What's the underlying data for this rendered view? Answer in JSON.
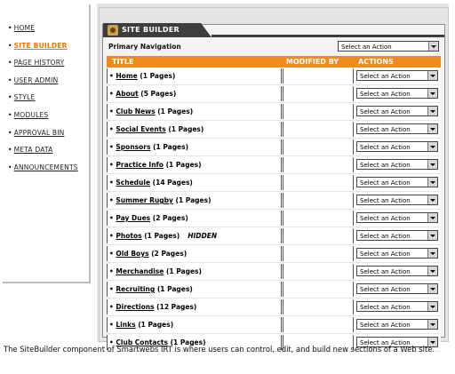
{
  "nav": {
    "items": [
      {
        "label": "HOME",
        "active": false
      },
      {
        "label": "SITE BUILDER",
        "active": true
      },
      {
        "label": "PAGE HISTORY",
        "active": false
      },
      {
        "label": "USER ADMIN",
        "active": false
      },
      {
        "label": "STYLE",
        "active": false
      },
      {
        "label": "MODULES",
        "active": false
      },
      {
        "label": "APPROVAL BIN",
        "active": false
      },
      {
        "label": "META DATA",
        "active": false
      },
      {
        "label": "ANNOUNCEMENTS",
        "active": false
      }
    ]
  },
  "panel": {
    "title": "SITE BUILDER",
    "primary_label": "Primary Navigation",
    "primary_select": "Select an Action"
  },
  "table": {
    "headers": {
      "title": "TITLE",
      "modified": "MODIFIED BY",
      "actions": "ACTIONS"
    },
    "action_default": "Select an Action",
    "rows": [
      {
        "name": "Home",
        "count": "(1 Pages)",
        "note": ""
      },
      {
        "name": "About",
        "count": "(5 Pages)",
        "note": ""
      },
      {
        "name": "Club News",
        "count": "(1 Pages)",
        "note": ""
      },
      {
        "name": "Social Events",
        "count": "(1 Pages)",
        "note": ""
      },
      {
        "name": "Sponsors",
        "count": "(1 Pages)",
        "note": ""
      },
      {
        "name": "Practice Info",
        "count": "(1 Pages)",
        "note": ""
      },
      {
        "name": "Schedule",
        "count": "(14 Pages)",
        "note": ""
      },
      {
        "name": "Summer Rugby",
        "count": "(1 Pages)",
        "note": ""
      },
      {
        "name": "Pay Dues",
        "count": "(2 Pages)",
        "note": ""
      },
      {
        "name": "Photos",
        "count": "(1 Pages)",
        "note": "HIDDEN"
      },
      {
        "name": "Old Boys",
        "count": "(2 Pages)",
        "note": ""
      },
      {
        "name": "Merchandise",
        "count": "(1 Pages)",
        "note": ""
      },
      {
        "name": "Recruiting",
        "count": "(1 Pages)",
        "note": ""
      },
      {
        "name": "Directions",
        "count": "(12 Pages)",
        "note": ""
      },
      {
        "name": "Links",
        "count": "(1 Pages)",
        "note": ""
      },
      {
        "name": "Club Contacts",
        "count": "(1 Pages)",
        "note": ""
      }
    ]
  },
  "caption": "The SiteBuilder component of Smartwebs IRT is where users can control, edit, and build new sections of a Web site.",
  "colors": {
    "accent": "#f08a1c",
    "active_nav": "#e07a10",
    "tab": "#3d3d3d"
  }
}
